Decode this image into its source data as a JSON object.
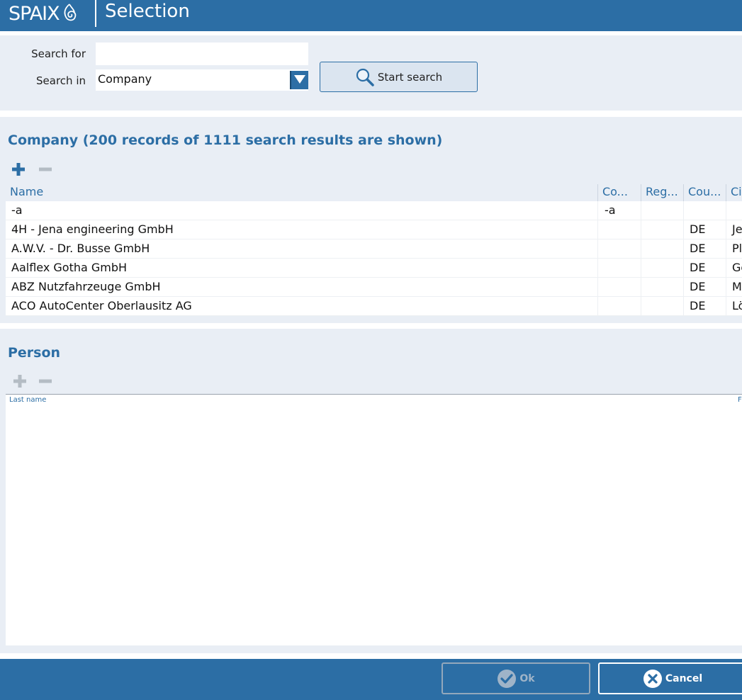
{
  "header": {
    "logo_text": "SPAIX",
    "title": "Selection"
  },
  "search": {
    "search_for_label": "Search for",
    "search_for_value": "",
    "search_in_label": "Search in",
    "search_in_value": "Company",
    "start_button_label": "Start search",
    "icon": "magnifier-icon"
  },
  "company": {
    "title": "Company (200 records of 1111 search results are shown)",
    "columns": [
      "Name",
      "Co...",
      "Reg...",
      "Cou...",
      "Ci"
    ],
    "rows": [
      [
        "-a",
        "-a",
        "",
        "",
        ""
      ],
      [
        "4H - Jena engineering GmbH",
        "",
        "",
        "DE",
        "Je"
      ],
      [
        "A.W.V. - Dr. Busse GmbH",
        "",
        "",
        "DE",
        "Pl"
      ],
      [
        "Aalflex Gotha GmbH",
        "",
        "",
        "DE",
        "Go"
      ],
      [
        "ABZ Nutzfahrzeuge GmbH",
        "",
        "",
        "DE",
        "M"
      ],
      [
        "ACO AutoCenter Oberlausitz AG",
        "",
        "",
        "DE",
        "Lö"
      ]
    ]
  },
  "person": {
    "title": "Person",
    "columns": [
      "Last name",
      "F"
    ]
  },
  "footer": {
    "ok_label": "Ok",
    "cancel_label": "Cancel"
  },
  "colors": {
    "brand": "#2c6ea5",
    "panel": "#e9eef5"
  }
}
